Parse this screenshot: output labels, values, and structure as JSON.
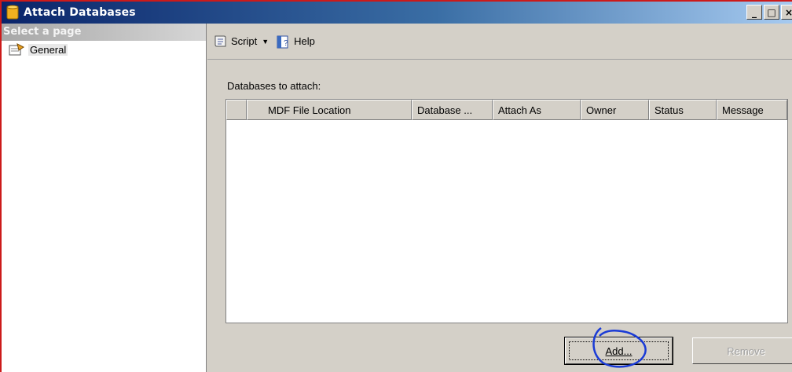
{
  "window": {
    "title": "Attach Databases",
    "icon": "database-icon",
    "minimize_icon": "minimize-icon",
    "maximize_icon": "maximize-icon",
    "close_icon": "close-icon"
  },
  "sidebar": {
    "header": "Select a page",
    "items": [
      {
        "label": "General",
        "icon": "general-page-icon",
        "selected": true
      }
    ]
  },
  "toolbar": {
    "script_label": "Script",
    "script_icon": "script-icon",
    "help_label": "Help",
    "help_icon": "help-icon"
  },
  "main": {
    "databases_label": "Databases to attach:",
    "columns": [
      "",
      "MDF File Location",
      "Database ...",
      "Attach As",
      "Owner",
      "Status",
      "Message"
    ],
    "rows": []
  },
  "buttons": {
    "add_label": "Add...",
    "remove_label": "Remove"
  },
  "colors": {
    "titlebar_start": "#0a246a",
    "titlebar_end": "#a6caf0",
    "annotation_circle": "#1a3bd6",
    "window_border": "#cc1a1a"
  }
}
